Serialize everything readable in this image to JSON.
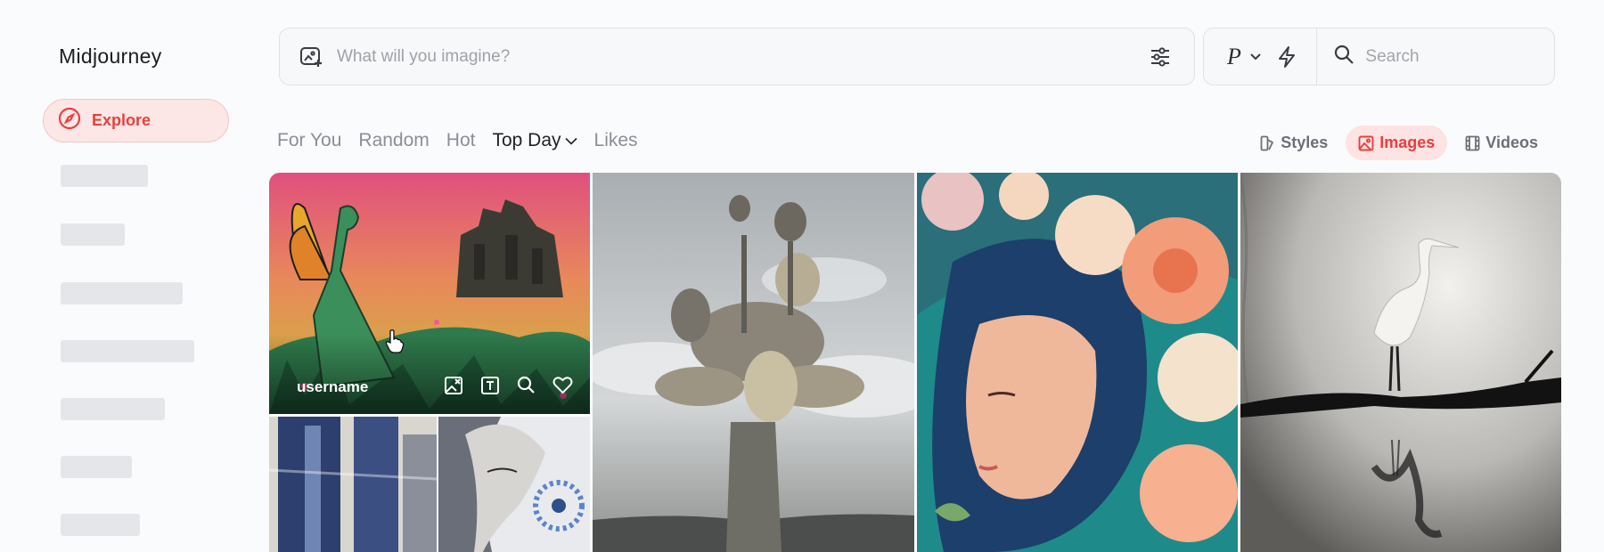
{
  "app": {
    "name": "Midjourney"
  },
  "sidebar": {
    "explore_label": "Explore",
    "placeholder_count": 7
  },
  "prompt": {
    "placeholder": "What will you imagine?",
    "value": ""
  },
  "controls": {
    "personalize_label": "P",
    "search_placeholder": "Search"
  },
  "feed_tabs": [
    {
      "label": "For You",
      "active": false
    },
    {
      "label": "Random",
      "active": false
    },
    {
      "label": "Hot",
      "active": false
    },
    {
      "label": "Top Day",
      "active": true
    },
    {
      "label": "Likes",
      "active": false
    }
  ],
  "media_filters": [
    {
      "label": "Styles",
      "icon": "styles-icon",
      "active": false
    },
    {
      "label": "Images",
      "icon": "image-icon",
      "active": true
    },
    {
      "label": "Videos",
      "icon": "film-icon",
      "active": false
    }
  ],
  "gallery": {
    "hovered_tile": {
      "username": "username",
      "actions": [
        "use-image-icon",
        "use-text-icon",
        "search-icon",
        "heart-icon"
      ]
    },
    "tiles": [
      {
        "subject": "butterfly-winged woman in green in front of ruined city"
      },
      {
        "subject": "blue abstract textured painting"
      },
      {
        "subject": "woman face with blue flower"
      },
      {
        "subject": "stone mushroom-shaped sculpture tree under clouds"
      },
      {
        "subject": "woman with teal hair and peach flowers"
      },
      {
        "subject": "egret standing on branch over misty water"
      }
    ]
  },
  "colors": {
    "accent": "#e5413e",
    "accent_bg": "#fde6e6",
    "muted_text": "#8b8e96",
    "skeleton": "#e5e6ea"
  }
}
